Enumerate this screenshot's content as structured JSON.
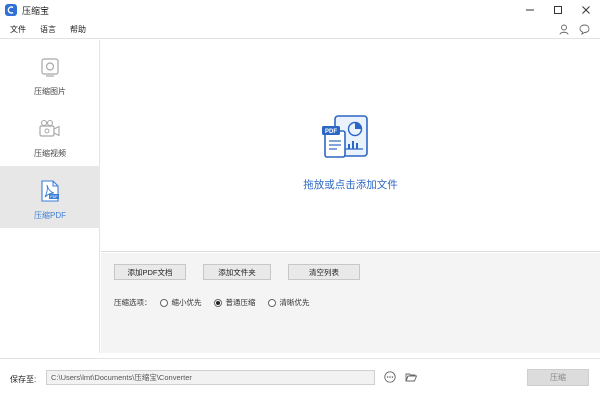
{
  "window": {
    "title": "压缩宝",
    "controls": [
      "minimize",
      "maximize",
      "close"
    ]
  },
  "menu": {
    "items": [
      "文件",
      "语言",
      "帮助"
    ],
    "right_icons": [
      "user-icon",
      "chat-icon"
    ]
  },
  "sidebar": {
    "items": [
      {
        "label": "压缩图片",
        "icon": "image-icon",
        "active": false
      },
      {
        "label": "压缩视频",
        "icon": "video-icon",
        "active": false
      },
      {
        "label": "压缩PDF",
        "icon": "pdf-icon",
        "active": true
      }
    ]
  },
  "dropzone": {
    "text": "拖放或点击添加文件",
    "illustration": "pdf-chart-illustration"
  },
  "options": {
    "buttons": [
      "添加PDF文档",
      "添加文件夹",
      "清空列表"
    ],
    "compress_label": "压缩选项：",
    "radios": [
      {
        "label": "缩小优先",
        "selected": false
      },
      {
        "label": "普通压缩",
        "selected": true
      },
      {
        "label": "清晰优先",
        "selected": false
      }
    ]
  },
  "bottom": {
    "save_label": "保存至:",
    "path": "C:\\Users\\lmt\\Documents\\压缩宝\\Converter",
    "compress_button": "压缩"
  },
  "colors": {
    "accent": "#2d67c4",
    "active_sidebar_bg": "#e7e7e7",
    "app_icon": "#2f6fd6"
  }
}
